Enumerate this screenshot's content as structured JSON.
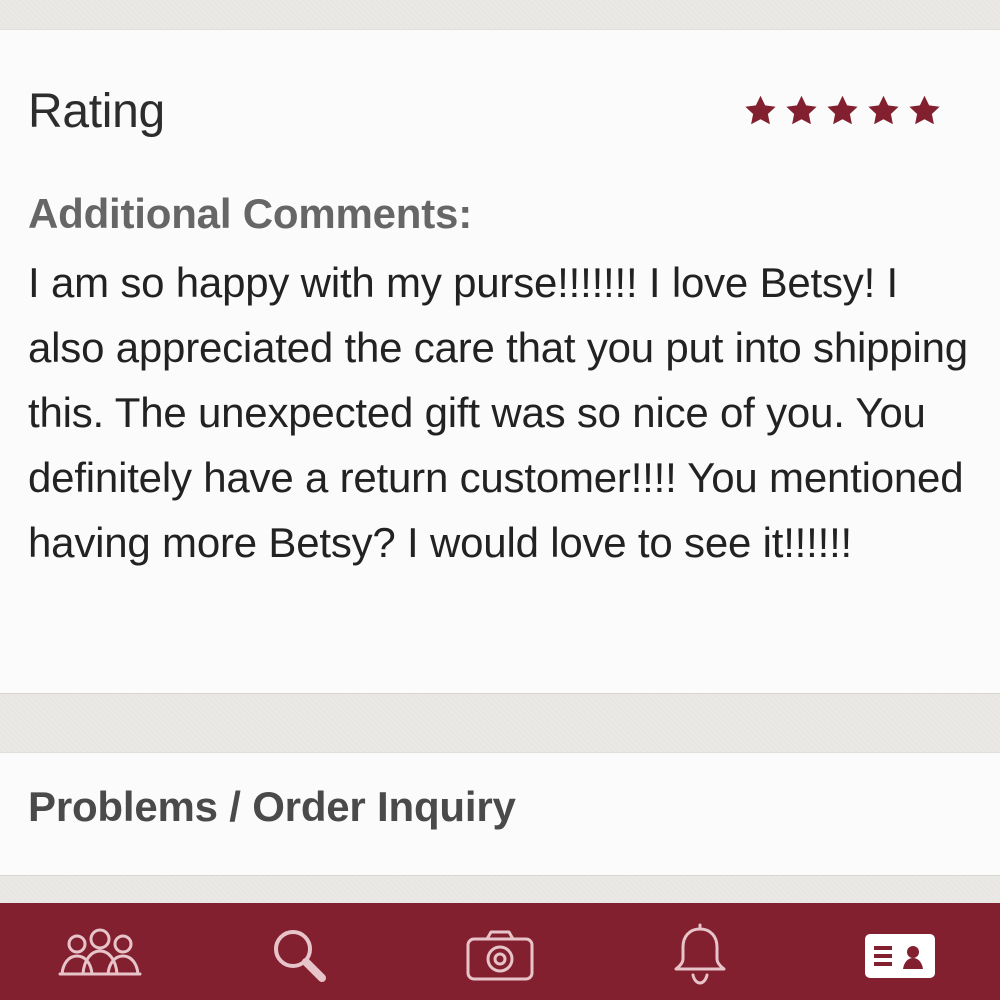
{
  "review": {
    "rating_label": "Rating",
    "rating_value": 5,
    "rating_max": 5,
    "comments_heading": "Additional Comments:",
    "comments_text": "I am so happy with my purse!!!!!!! I love Betsy! I also appreciated the care that you put into shipping this. The unexpected gift was so nice of you. You definitely have a return customer!!!! You mentioned having more Betsy? I would love to see it!!!!!!"
  },
  "problems": {
    "label": "Problems / Order Inquiry"
  },
  "tabbar": {
    "items": [
      {
        "icon": "people-icon"
      },
      {
        "icon": "search-icon"
      },
      {
        "icon": "camera-icon"
      },
      {
        "icon": "bell-icon"
      },
      {
        "icon": "profile-card-icon",
        "active": true
      }
    ]
  },
  "colors": {
    "accent": "#83202f",
    "star": "#83202f",
    "tab_icon_inactive": "#e7c4c9",
    "tab_icon_active": "#ffffff"
  }
}
